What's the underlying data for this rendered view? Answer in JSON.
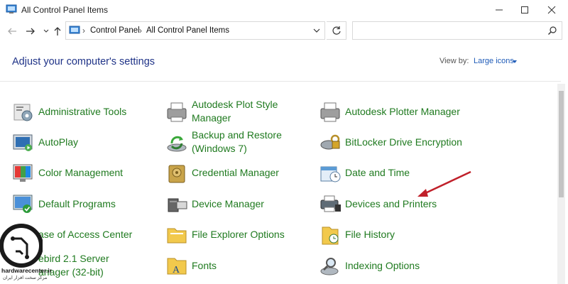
{
  "window": {
    "title": "All Control Panel Items"
  },
  "address": {
    "crumbs": [
      "Control Panel",
      "All Control Panel Items"
    ]
  },
  "search": {
    "placeholder": ""
  },
  "header": {
    "heading": "Adjust your computer's settings",
    "view_by_label": "View by:",
    "view_by_value": "Large icons"
  },
  "items": [
    {
      "label": "Administrative Tools",
      "icon": "admin-tools-icon"
    },
    {
      "label": "Autodesk Plot Style",
      "label2": "Manager",
      "icon": "plot-style-icon"
    },
    {
      "label": "Autodesk Plotter Manager",
      "icon": "plotter-icon"
    },
    {
      "label": "AutoPlay",
      "icon": "autoplay-icon"
    },
    {
      "label": "Backup and Restore",
      "label2": "(Windows 7)",
      "icon": "backup-icon"
    },
    {
      "label": "BitLocker Drive Encryption",
      "icon": "bitlocker-icon"
    },
    {
      "label": "Color Management",
      "icon": "color-management-icon"
    },
    {
      "label": "Credential Manager",
      "icon": "credential-icon"
    },
    {
      "label": "Date and Time",
      "icon": "date-time-icon"
    },
    {
      "label": "Default Programs",
      "icon": "default-programs-icon"
    },
    {
      "label": "Device Manager",
      "icon": "device-manager-icon"
    },
    {
      "label": "Devices and Printers",
      "icon": "devices-printers-icon"
    },
    {
      "label": "ase of Access Center",
      "icon": "ease-of-access-icon"
    },
    {
      "label": "File Explorer Options",
      "icon": "folder-options-icon"
    },
    {
      "label": "File History",
      "icon": "file-history-icon"
    },
    {
      "label": "ebird 2.1 Server",
      "label2": "anager (32-bit)",
      "icon": "firebird-icon"
    },
    {
      "label": "Fonts",
      "icon": "fonts-icon"
    },
    {
      "label": "Indexing Options",
      "icon": "indexing-icon"
    }
  ],
  "watermark": {
    "line1": "hardwarecenter.ir",
    "line2": "مرکز سخت افزار ایران"
  },
  "colors": {
    "link_green": "#1f7a1f",
    "heading_blue": "#1e3287",
    "arrow_red": "#c0202a"
  }
}
